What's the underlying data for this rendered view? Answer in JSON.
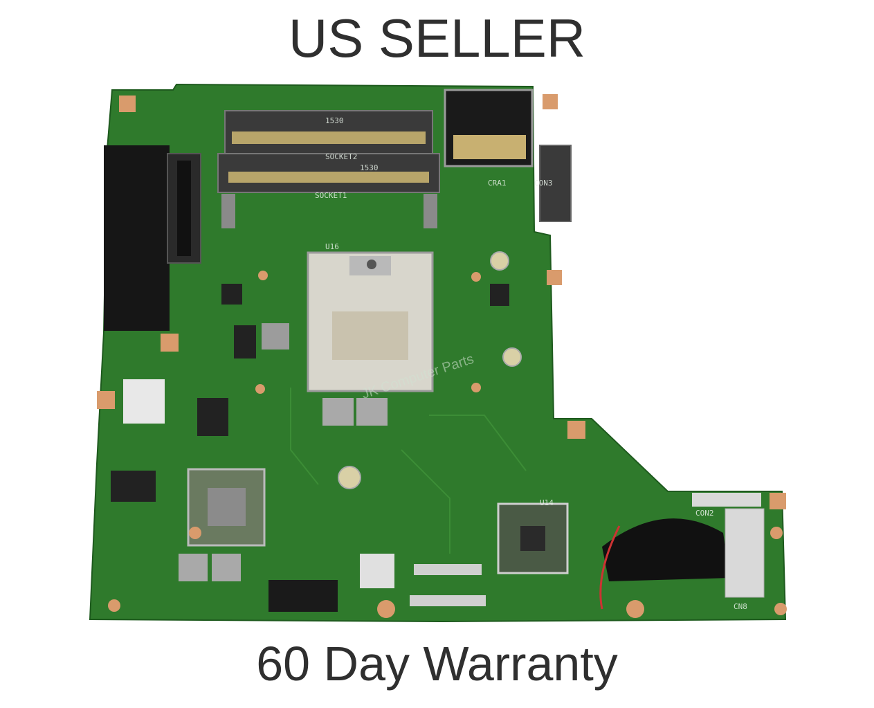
{
  "caption": {
    "top": "US SELLER",
    "bottom": "60 Day Warranty"
  },
  "watermark": "JK Computer Parts",
  "board_labels": {
    "socket2": "SOCKET2",
    "socket1": "SOCKET1",
    "u16": "U16",
    "u14": "U14",
    "cra1": "CRA1",
    "con3": "CON3",
    "cn8": "CN8",
    "con2": "CON2",
    "l530": "1530"
  },
  "colors": {
    "pcb": "#2f7a2c",
    "pcb_dark": "#1f5a1f",
    "text": "#2f2f2f",
    "pad": "#d99b6c"
  }
}
